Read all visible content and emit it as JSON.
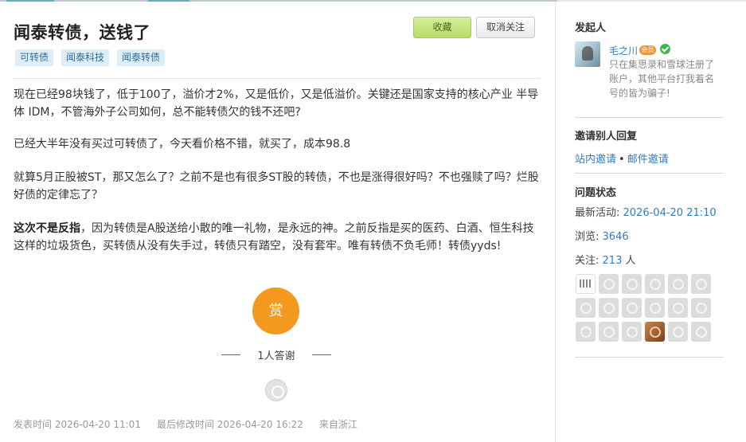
{
  "post": {
    "title": "闻泰转债，送钱了",
    "favorite_label": "收藏",
    "unfollow_label": "取消关注",
    "tags": [
      "可转债",
      "闻泰科技",
      "闻泰转债"
    ],
    "paragraphs": {
      "p1": "现在已经98块钱了，低于100了，溢价才2%，又是低价，又是低溢价。关键还是国家支持的核心产业 半导体 IDM，不管海外子公司如何，总不能转债欠的钱不还吧?",
      "p2": "已经大半年没有买过可转债了，今天看价格不错，就买了，成本98.8",
      "p3": "就算5月正股被ST，那又怎么了？之前不是也有很多ST股的转债，不也是涨得很好吗？不也强赎了吗？烂股好债的定律忘了？",
      "p4_bold": "这次不是反指",
      "p4_rest": "，因为转债是A股送给小散的唯一礼物，是永远的神。之前反指是买的医药、白酒、恒生科技这样的垃圾货色，买转债从没有失手过，转债只有踏空，没有套牢。唯有转债不负毛师！转债yyds!"
    },
    "reward_label": "赏",
    "thanks_text": "1人答谢",
    "meta": {
      "published": "发表时间 2026-04-20 11:01",
      "modified": "最后修改时间 2026-04-20 16:22",
      "location": "来自浙江"
    }
  },
  "sidebar": {
    "initiator_heading": "发起人",
    "user": {
      "name": "毛之川",
      "badge": "会员",
      "bio": "只在集思录和雪球注册了账户，其他平台打我着名号的皆为骗子!"
    },
    "invite_heading": "邀请别人回复",
    "invite_site": "站内邀请",
    "invite_dot": "•",
    "invite_email": "邮件邀请",
    "status_heading": "问题状态",
    "status": {
      "activity_label": "最新活动:",
      "activity_value": "2026-04-20 21:10",
      "views_label": "浏览:",
      "views_value": "3646",
      "follow_label": "关注:",
      "follow_value": "213",
      "follow_unit": "人"
    }
  },
  "colors": {
    "link": "#2f7bbf",
    "reward": "#f39a1e",
    "favorite_button": "#b7dc6a",
    "tag_bg": "#ddeef8",
    "verified": "#44b549"
  }
}
